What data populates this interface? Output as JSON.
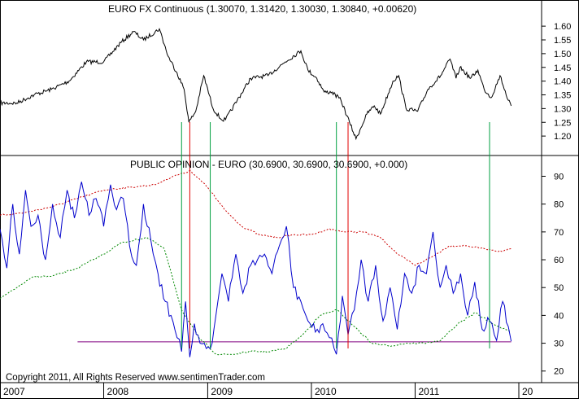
{
  "copyright": "Copyright 2011, All Rights Reserved  www.sentimenTrader.com",
  "colors": {
    "price_line": "#000000",
    "sentiment_line": "#0000cc",
    "upper_band": "#cc0000",
    "lower_band": "#008800",
    "extreme_line": "#800080",
    "green_marker": "#00a040",
    "red_marker": "#e00000"
  },
  "chart_data": [
    {
      "type": "line",
      "title": "EURO FX Continuous (1.30070, 1.31420, 1.30030, 1.30840, +0.00620)",
      "y_ticks": [
        "1.60",
        "1.55",
        "1.50",
        "1.45",
        "1.40",
        "1.35",
        "1.30",
        "1.25",
        "1.20"
      ],
      "ylim": [
        1.15,
        1.63
      ],
      "grid": false,
      "series": [
        {
          "x": [
            "2007-01-01",
            "2007-03-01",
            "2007-05-01",
            "2007-07-01",
            "2007-09-01",
            "2007-11-01",
            "2008-01-01",
            "2008-03-01",
            "2008-04-15",
            "2008-05-20",
            "2008-07-15",
            "2008-08-15",
            "2008-09-15",
            "2008-10-10",
            "2008-10-27",
            "2008-11-20",
            "2008-12-18",
            "2009-01-20",
            "2009-02-18",
            "2009-03-05",
            "2009-04-15",
            "2009-06-01",
            "2009-08-01",
            "2009-10-01",
            "2009-11-25",
            "2009-12-20",
            "2010-01-20",
            "2010-02-15",
            "2010-03-15",
            "2010-04-15",
            "2010-05-15",
            "2010-06-07",
            "2010-07-15",
            "2010-08-10",
            "2010-09-01",
            "2010-10-15",
            "2010-11-04",
            "2010-11-30",
            "2011-01-10",
            "2011-02-15",
            "2011-04-01",
            "2011-05-04",
            "2011-05-25",
            "2011-06-08",
            "2011-07-15",
            "2011-08-10",
            "2011-09-01",
            "2011-09-26",
            "2011-10-27",
            "2011-11-25",
            "2011-12-05"
          ],
          "values": [
            1.32,
            1.32,
            1.35,
            1.37,
            1.4,
            1.47,
            1.47,
            1.54,
            1.58,
            1.55,
            1.59,
            1.49,
            1.43,
            1.37,
            1.25,
            1.29,
            1.42,
            1.3,
            1.26,
            1.26,
            1.33,
            1.41,
            1.42,
            1.47,
            1.51,
            1.44,
            1.41,
            1.36,
            1.36,
            1.33,
            1.25,
            1.19,
            1.28,
            1.31,
            1.28,
            1.4,
            1.42,
            1.3,
            1.29,
            1.37,
            1.42,
            1.48,
            1.41,
            1.45,
            1.41,
            1.44,
            1.37,
            1.34,
            1.42,
            1.33,
            1.31
          ]
        }
      ]
    },
    {
      "type": "line",
      "title": "PUBLIC OPINION - EURO (30.6900, 30.6900, 30.6900, +0.000)",
      "y_ticks": [
        "90",
        "80",
        "70",
        "60",
        "50",
        "40",
        "30",
        "20"
      ],
      "ylim": [
        17,
        96
      ],
      "x_labels": [
        "2007",
        "2008",
        "2009",
        "2010",
        "2011",
        "20"
      ],
      "grid": false,
      "series": [
        {
          "x": [
            "2007-01-01",
            "2007-01-25",
            "2007-02-15",
            "2007-03-10",
            "2007-04-01",
            "2007-04-20",
            "2007-05-15",
            "2007-06-10",
            "2007-07-05",
            "2007-08-01",
            "2007-08-25",
            "2007-09-20",
            "2007-10-15",
            "2007-11-10",
            "2007-12-05",
            "2008-01-01",
            "2008-01-25",
            "2008-02-15",
            "2008-03-10",
            "2008-04-01",
            "2008-04-25",
            "2008-05-20",
            "2008-06-15",
            "2008-07-10",
            "2008-08-05",
            "2008-08-25",
            "2008-09-15",
            "2008-10-01",
            "2008-10-15",
            "2008-10-30",
            "2008-11-15",
            "2008-12-05",
            "2008-12-20",
            "2009-01-10",
            "2009-01-30",
            "2009-02-20",
            "2009-03-15",
            "2009-04-10",
            "2009-05-05",
            "2009-06-01",
            "2009-06-25",
            "2009-07-20",
            "2009-08-15",
            "2009-09-10",
            "2009-10-05",
            "2009-10-30",
            "2009-11-25",
            "2009-12-20",
            "2010-01-15",
            "2010-02-10",
            "2010-03-05",
            "2010-03-30",
            "2010-04-20",
            "2010-05-10",
            "2010-06-01",
            "2010-06-25",
            "2010-07-20",
            "2010-08-15",
            "2010-09-10",
            "2010-10-05",
            "2010-10-30",
            "2010-11-25",
            "2010-12-20",
            "2011-01-15",
            "2011-02-10",
            "2011-03-05",
            "2011-03-30",
            "2011-04-20",
            "2011-05-15",
            "2011-06-10",
            "2011-07-05",
            "2011-07-30",
            "2011-08-25",
            "2011-09-20",
            "2011-10-15",
            "2011-11-05",
            "2011-11-25",
            "2011-12-05"
          ],
          "values": [
            71,
            57,
            80,
            62,
            85,
            72,
            76,
            60,
            80,
            68,
            85,
            75,
            88,
            76,
            82,
            72,
            87,
            78,
            82,
            65,
            58,
            80,
            67,
            55,
            45,
            40,
            32,
            27,
            45,
            25,
            37,
            30,
            30,
            28,
            40,
            55,
            45,
            62,
            48,
            58,
            60,
            62,
            55,
            65,
            72,
            50,
            45,
            38,
            34,
            37,
            32,
            26,
            47,
            33,
            42,
            60,
            45,
            58,
            38,
            50,
            35,
            55,
            48,
            58,
            55,
            70,
            50,
            58,
            48,
            55,
            40,
            52,
            35,
            38,
            31,
            45,
            36,
            30.69
          ]
        },
        {
          "x": [
            "2007-01-01",
            "2007-04-01",
            "2007-07-01",
            "2007-10-01",
            "2008-01-01",
            "2008-04-01",
            "2008-07-01",
            "2008-09-01",
            "2008-11-01",
            "2009-01-01",
            "2009-03-01",
            "2009-05-01",
            "2009-07-01",
            "2009-09-01",
            "2009-11-01",
            "2010-01-01",
            "2010-03-01",
            "2010-05-01",
            "2010-07-01",
            "2010-09-01",
            "2010-11-01",
            "2011-01-01",
            "2011-03-01",
            "2011-05-01",
            "2011-07-01",
            "2011-09-01",
            "2011-11-01",
            "2011-12-05"
          ],
          "values": [
            76,
            77,
            79,
            82,
            85,
            86,
            87,
            90,
            92,
            86,
            78,
            72,
            69,
            68,
            69,
            69,
            71,
            70,
            70,
            68,
            62,
            58,
            61,
            65,
            65,
            64,
            63,
            64
          ]
        },
        {
          "x": [
            "2007-01-01",
            "2007-03-01",
            "2007-05-01",
            "2007-07-01",
            "2007-10-01",
            "2008-01-01",
            "2008-03-01",
            "2008-06-01",
            "2008-08-01",
            "2008-10-01",
            "2008-12-01",
            "2009-02-01",
            "2009-04-01",
            "2009-06-01",
            "2009-08-01",
            "2009-10-01",
            "2009-12-01",
            "2010-02-01",
            "2010-04-01",
            "2010-06-01",
            "2010-08-01",
            "2010-10-01",
            "2010-12-01",
            "2011-02-01",
            "2011-04-01",
            "2011-06-01",
            "2011-08-01",
            "2011-10-01",
            "2011-12-05"
          ],
          "values": [
            46,
            50,
            54,
            54,
            57,
            62,
            66,
            68,
            64,
            42,
            32,
            26,
            26,
            27,
            27,
            28,
            33,
            40,
            42,
            36,
            30,
            29,
            30,
            30,
            31,
            37,
            41,
            37,
            34
          ]
        },
        {
          "x": [
            "2007-10-01",
            "2011-12-05"
          ],
          "values": [
            30.5,
            30.5
          ]
        }
      ]
    }
  ],
  "markers": [
    {
      "date": "2008-10-01",
      "color": "green"
    },
    {
      "date": "2008-10-30",
      "color": "red"
    },
    {
      "date": "2009-01-10",
      "color": "green"
    },
    {
      "date": "2010-03-30",
      "color": "green"
    },
    {
      "date": "2010-05-10",
      "color": "red"
    },
    {
      "date": "2011-09-20",
      "color": "green"
    }
  ]
}
